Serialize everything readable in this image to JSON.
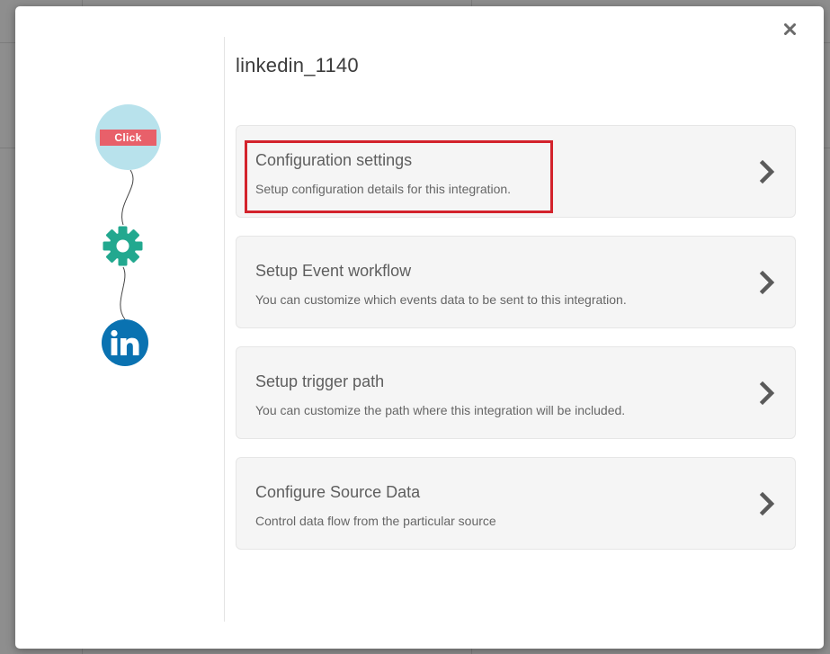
{
  "modal": {
    "title": "linkedin_1140",
    "close_icon": "close-icon"
  },
  "flow": {
    "click_label": "Click",
    "gear_icon": "gear-icon",
    "linkedin_icon": "linkedin-icon",
    "linkedin_text": "in",
    "colors": {
      "click_circle": "#b8e2ec",
      "click_tag": "#e8606a",
      "gear": "#22a88f",
      "linkedin": "#0a72b1"
    }
  },
  "cards": [
    {
      "heading": "Configuration settings",
      "description": "Setup configuration details for this integration.",
      "highlighted": true
    },
    {
      "heading": "Setup Event workflow",
      "description": "You can customize which events data to be sent to this integration."
    },
    {
      "heading": "Setup trigger path",
      "description": "You can customize the path where this integration will be included."
    },
    {
      "heading": "Configure Source Data",
      "description": "Control data flow from the particular source"
    }
  ],
  "highlight_color": "#d3232c"
}
